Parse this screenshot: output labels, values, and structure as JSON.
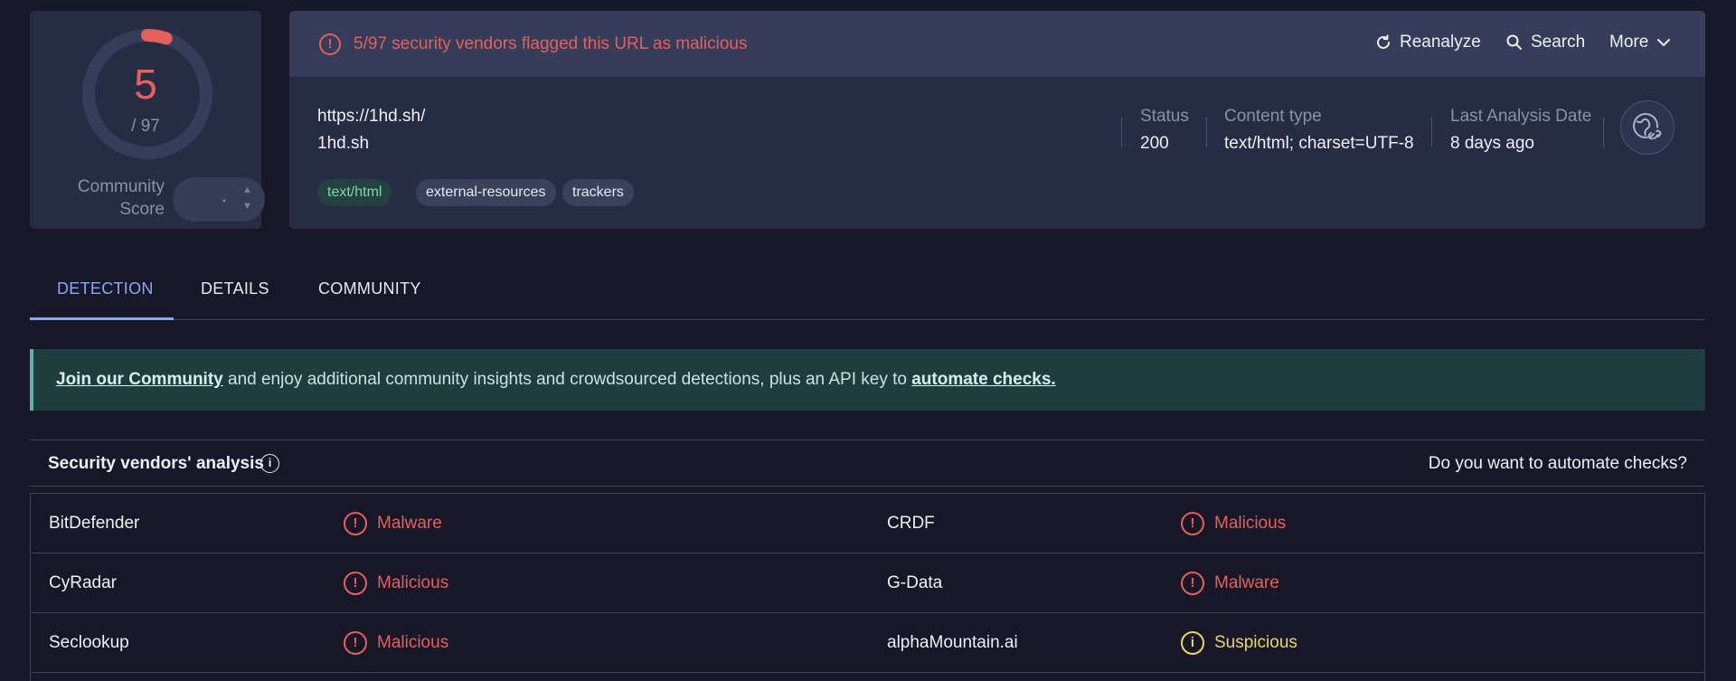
{
  "score": {
    "detections": "5",
    "total": "/ 97",
    "fraction": 0.0515,
    "community_label_1": "Community",
    "community_label_2": "Score",
    "vote_dot": "•"
  },
  "banner": {
    "message": "5/97 security vendors flagged this URL as malicious",
    "alert_glyph": "!",
    "actions": {
      "reanalyze": "Reanalyze",
      "search": "Search",
      "more": "More"
    }
  },
  "url": {
    "full": "https://1hd.sh/",
    "host": "1hd.sh"
  },
  "tags": [
    "text/html",
    "external-resources",
    "trackers"
  ],
  "meta": {
    "status_label": "Status",
    "status_value": "200",
    "content_label": "Content type",
    "content_value": "text/html; charset=UTF-8",
    "date_label": "Last Analysis Date",
    "date_value": "8 days ago"
  },
  "tabs": [
    {
      "label": "DETECTION",
      "active": true
    },
    {
      "label": "DETAILS",
      "active": false
    },
    {
      "label": "COMMUNITY",
      "active": false
    }
  ],
  "join": {
    "link1": "Join our Community",
    "middle": " and enjoy additional community insights and crowdsourced detections, plus an API key to ",
    "link2": "automate checks."
  },
  "vendors": {
    "title": "Security vendors' analysis",
    "info_glyph": "i",
    "automate_question": "Do you want to automate checks?",
    "rows": [
      {
        "left_name": "BitDefender",
        "left_result": "Malware",
        "left_glyph": "!",
        "right_name": "CRDF",
        "right_result": "Malicious",
        "right_glyph": "!"
      },
      {
        "left_name": "CyRadar",
        "left_result": "Malicious",
        "left_glyph": "!",
        "right_name": "G-Data",
        "right_result": "Malware",
        "right_glyph": "!"
      },
      {
        "left_name": "Seclookup",
        "left_result": "Malicious",
        "left_glyph": "!",
        "right_name": "alphaMountain.ai",
        "right_result": "Suspicious",
        "right_glyph": "i"
      }
    ]
  },
  "colors": {
    "malicious": "#e5605d",
    "suspicious": "#e6d862",
    "accent": "#8ea6f0"
  }
}
